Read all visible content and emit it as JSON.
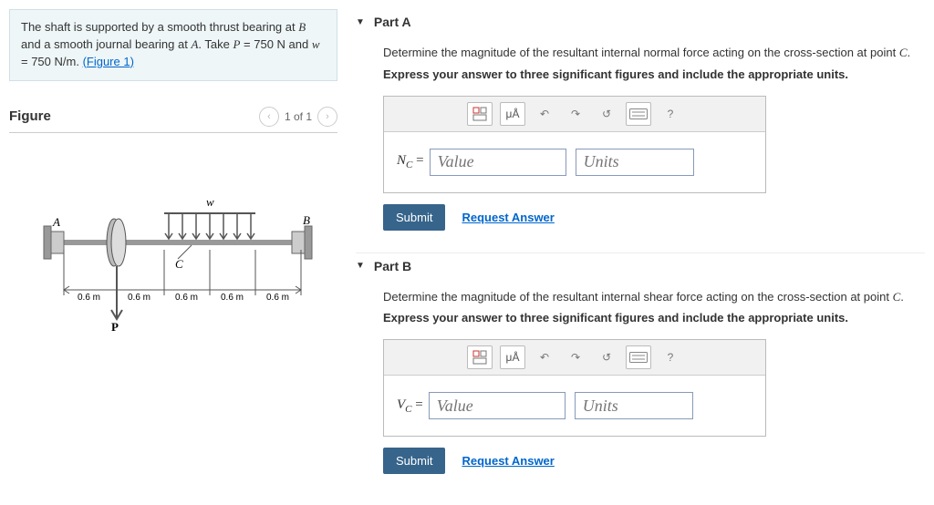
{
  "problem": {
    "intro_pre": "The shaft is supported by a smooth thrust bearing at ",
    "B": "B",
    "intro_mid": " and a smooth journal bearing at ",
    "A": "A",
    "intro_take": ". Take ",
    "P": "P",
    "eq1": " = 750 N and ",
    "w": "w",
    "eq2": " = 750 N/m. ",
    "figlink": "(Figure 1)"
  },
  "figure": {
    "title": "Figure",
    "counter": "1 of 1",
    "labels": {
      "A": "A",
      "B": "B",
      "C": "C",
      "w": "w",
      "P": "P",
      "d": "0.6 m"
    }
  },
  "parts": {
    "A": {
      "title": "Part A",
      "q_pre": "Determine the magnitude of the resultant internal normal force acting on the cross-section at point ",
      "q_var": "C",
      "q_post": ".",
      "inst": "Express your answer to three significant figures and include the appropriate units.",
      "lhs_sym": "N",
      "lhs_sub": "C",
      "eq": " = ",
      "value_ph": "Value",
      "units_ph": "Units",
      "submit": "Submit",
      "req": "Request Answer"
    },
    "B": {
      "title": "Part B",
      "q_pre": "Determine the magnitude of the resultant internal shear force acting on the cross-section at point ",
      "q_var": "C",
      "q_post": ".",
      "inst": "Express your answer to three significant figures and include the appropriate units.",
      "lhs_sym": "V",
      "lhs_sub": "C",
      "eq": " = ",
      "value_ph": "Value",
      "units_ph": "Units",
      "submit": "Submit",
      "req": "Request Answer"
    }
  },
  "tools": {
    "ua": "μÅ",
    "help": "?"
  }
}
